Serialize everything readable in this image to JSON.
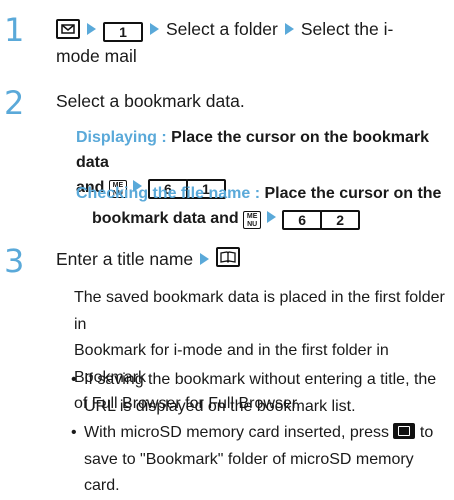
{
  "step1": {
    "number": "1",
    "key_mail_icon": "mail-key-icon",
    "key_1": "1",
    "text_a": "Select a folder",
    "text_b": "Select the i-",
    "text_c": "mode mail"
  },
  "step2": {
    "number": "2",
    "text": "Select a bookmark data.",
    "sub1_label": "Displaying :",
    "sub1_text_a": "Place the cursor on the bookmark data",
    "sub1_text_b": "and",
    "sub1_keys": [
      "6",
      "1"
    ],
    "sub2_label": "Checking the file name :",
    "sub2_text_a": "Place the cursor on the",
    "sub2_text_b": "bookmark data and",
    "sub2_keys": [
      "6",
      "2"
    ],
    "menu_key_top": "ME",
    "menu_key_bottom": "NU"
  },
  "step3": {
    "number": "3",
    "text": "Enter a title name",
    "para_lines": [
      "The saved bookmark data is placed in the first folder in",
      "Bookmark for i-mode and in the first folder in Bookmark",
      "of Full Browser for Full Browser."
    ],
    "bullet1": [
      "If saving the bookmark without entering a title, the",
      "URL is displayed on the bookmark list."
    ],
    "bullet2_a": "With microSD memory card inserted, press",
    "bullet2_b": "to",
    "bullet2_c": "save to \"Bookmark\" folder of microSD memory card.",
    "bullet_char": "•"
  },
  "colors": {
    "accent": "#5aa9d9",
    "text": "#1a1a1a"
  }
}
